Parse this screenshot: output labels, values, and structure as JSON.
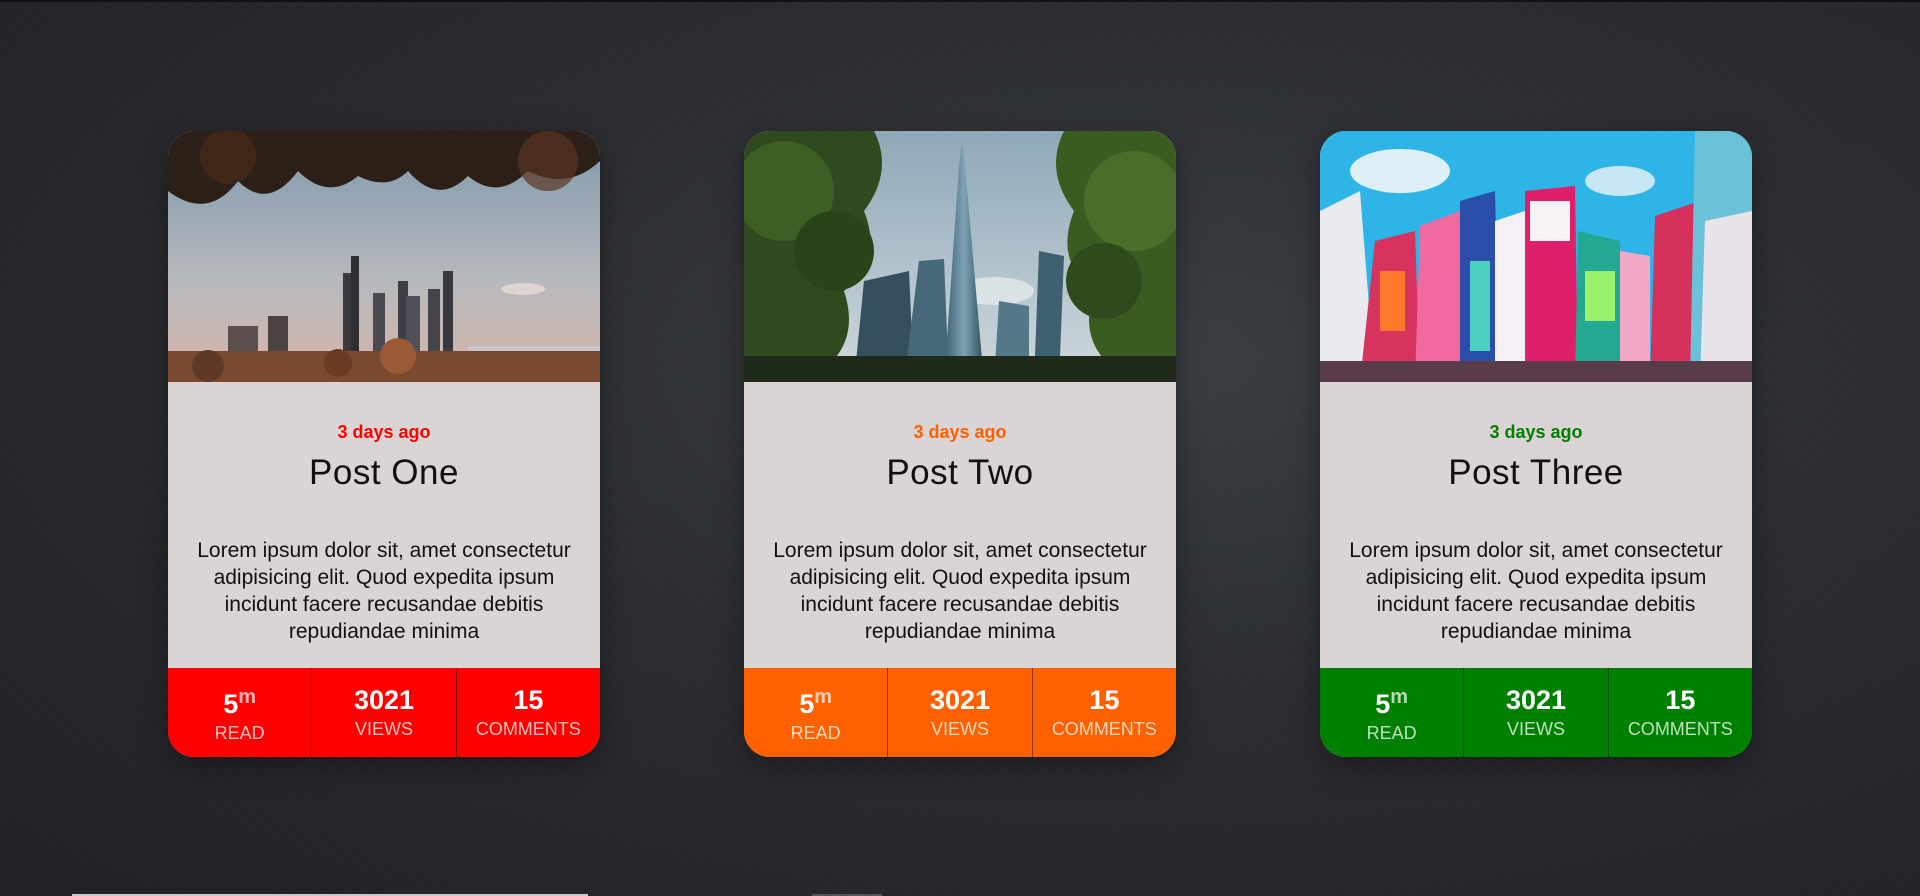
{
  "colors": {
    "post_one": "#ff0000",
    "post_two": "#ff6000",
    "post_three": "#008000"
  },
  "cards": [
    {
      "date": "3 days ago",
      "title": "Post One",
      "description": "Lorem ipsum dolor sit, amet consectetur adipisicing elit. Quod expedita ipsum incidunt facere recusandae debitis repudiandae minima",
      "stats": {
        "read_value": "5",
        "read_unit": "m",
        "read_label": "READ",
        "views_value": "3021",
        "views_label": "VIEWS",
        "comments_value": "15",
        "comments_label": "COMMENTS"
      }
    },
    {
      "date": "3 days ago",
      "title": "Post Two",
      "description": "Lorem ipsum dolor sit, amet consectetur adipisicing elit. Quod expedita ipsum incidunt facere recusandae debitis repudiandae minima",
      "stats": {
        "read_value": "5",
        "read_unit": "m",
        "read_label": "READ",
        "views_value": "3021",
        "views_label": "VIEWS",
        "comments_value": "15",
        "comments_label": "COMMENTS"
      }
    },
    {
      "date": "3 days ago",
      "title": "Post Three",
      "description": "Lorem ipsum dolor sit, amet consectetur adipisicing elit. Quod expedita ipsum incidunt facere recusandae debitis repudiandae minima",
      "stats": {
        "read_value": "5",
        "read_unit": "m",
        "read_label": "READ",
        "views_value": "3021",
        "views_label": "VIEWS",
        "comments_value": "15",
        "comments_label": "COMMENTS"
      }
    }
  ]
}
